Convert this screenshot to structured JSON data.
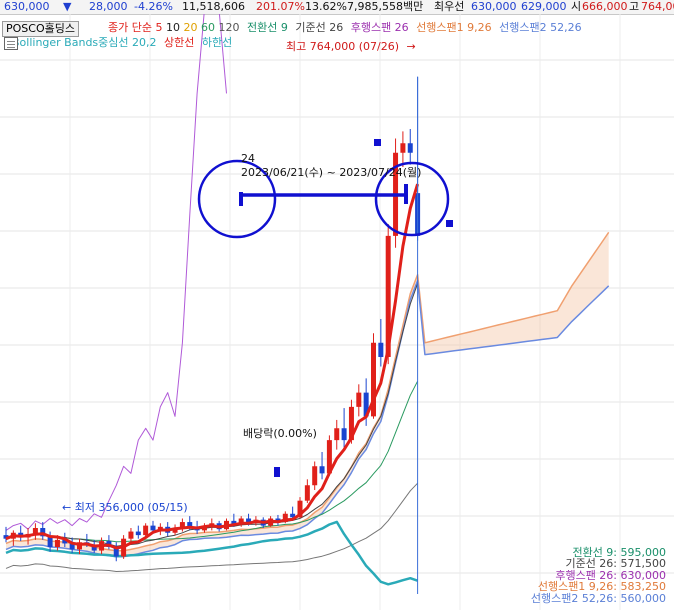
{
  "header": {
    "price": "630,000",
    "arrow": "▼",
    "change": "28,000",
    "change_pct": "-4.26%",
    "volume": "11,518,606",
    "volume_ratio": "201.07%",
    "turnover": "13.62%",
    "amount": "7,985,558백만",
    "best_ask_label": "최우선",
    "best_ask": "630,000",
    "best_bid": "629,000",
    "open_label": "시",
    "open": "666,000",
    "high_label": "고",
    "high": "764,00"
  },
  "legend": {
    "stock_name": "POSCO홀딩스",
    "ma_label": "종가 단순 5",
    "ma10": "10",
    "ma20": "20",
    "ma60": "60",
    "ma120": "120",
    "ichimoku_conv": "전환선 9",
    "ichimoku_base": "기준선 26",
    "ichimoku_lag": "후행스팬 26",
    "ichimoku_lead1": "선행스팬1 9,26",
    "ichimoku_lead2": "선행스팬2 52,26",
    "bb_label": "Bollinger Bands중심선 20,2",
    "bb_upper": "상한선",
    "bb_lower": "하한선"
  },
  "annotations": {
    "high_marker": "최고 764,000 (07/26)",
    "high_arrow": "→",
    "low_marker": "최저 356,000 (05/15)",
    "low_arrow": "←",
    "dividend": "배당락(0.00%)",
    "period_count": "24",
    "period_range": "2023/06/21(수) ~ 2023/07/24(월)"
  },
  "indicator_values": [
    {
      "text": "전환선 9: 595,000",
      "color": "#1a8f6a"
    },
    {
      "text": "기준선 26: 571,500",
      "color": "#444444"
    },
    {
      "text": "후행스팬 26: 630,000",
      "color": "#9b2fae"
    },
    {
      "text": "선행스팬1 9,26: 583,250",
      "color": "#e07a3a"
    },
    {
      "text": "선행스팬2 52,26: 560,000",
      "color": "#5a7fd6"
    }
  ],
  "colors": {
    "up": "#e0201a",
    "down": "#1a44d0",
    "ma5": "#e0201a",
    "lag_span": "#b05ad8",
    "lead1": "#f0a070",
    "lead2": "#6a8ae0",
    "bb": "#2aaab8",
    "conv": "#2a9a60",
    "base": "#555555",
    "annotation": "#1010d0"
  },
  "chart_data": {
    "type": "candlestick",
    "title": "POSCO홀딩스",
    "ylim": [
      320000,
      800000
    ],
    "grid": true,
    "high": {
      "value": 764000,
      "date": "07/26"
    },
    "low": {
      "value": 356000,
      "date": "05/15"
    },
    "period_selection": {
      "from": "2023/06/21",
      "to": "2023/07/24",
      "bars": 24
    },
    "candles": [
      {
        "o": 378000,
        "h": 385000,
        "l": 372000,
        "c": 375000
      },
      {
        "o": 375000,
        "h": 382000,
        "l": 369000,
        "c": 380000
      },
      {
        "o": 380000,
        "h": 386000,
        "l": 373000,
        "c": 376000
      },
      {
        "o": 376000,
        "h": 384000,
        "l": 370000,
        "c": 379000
      },
      {
        "o": 379000,
        "h": 388000,
        "l": 374000,
        "c": 384000
      },
      {
        "o": 384000,
        "h": 389000,
        "l": 374000,
        "c": 377000
      },
      {
        "o": 377000,
        "h": 381000,
        "l": 364000,
        "c": 368000
      },
      {
        "o": 368000,
        "h": 378000,
        "l": 365000,
        "c": 374000
      },
      {
        "o": 374000,
        "h": 380000,
        "l": 368000,
        "c": 371000
      },
      {
        "o": 371000,
        "h": 376000,
        "l": 363000,
        "c": 366000
      },
      {
        "o": 366000,
        "h": 375000,
        "l": 362000,
        "c": 372000
      },
      {
        "o": 372000,
        "h": 379000,
        "l": 368000,
        "c": 370000
      },
      {
        "o": 370000,
        "h": 374000,
        "l": 363000,
        "c": 365000
      },
      {
        "o": 365000,
        "h": 376000,
        "l": 362000,
        "c": 373000
      },
      {
        "o": 373000,
        "h": 378000,
        "l": 366000,
        "c": 368000
      },
      {
        "o": 368000,
        "h": 372000,
        "l": 356000,
        "c": 360000
      },
      {
        "o": 360000,
        "h": 378000,
        "l": 358000,
        "c": 375000
      },
      {
        "o": 375000,
        "h": 384000,
        "l": 371000,
        "c": 381000
      },
      {
        "o": 381000,
        "h": 386000,
        "l": 375000,
        "c": 378000
      },
      {
        "o": 378000,
        "h": 388000,
        "l": 376000,
        "c": 386000
      },
      {
        "o": 386000,
        "h": 390000,
        "l": 379000,
        "c": 382000
      },
      {
        "o": 382000,
        "h": 388000,
        "l": 378000,
        "c": 385000
      },
      {
        "o": 385000,
        "h": 389000,
        "l": 377000,
        "c": 380000
      },
      {
        "o": 380000,
        "h": 387000,
        "l": 378000,
        "c": 384000
      },
      {
        "o": 384000,
        "h": 392000,
        "l": 381000,
        "c": 389000
      },
      {
        "o": 389000,
        "h": 394000,
        "l": 382000,
        "c": 385000
      },
      {
        "o": 385000,
        "h": 390000,
        "l": 379000,
        "c": 382000
      },
      {
        "o": 382000,
        "h": 388000,
        "l": 380000,
        "c": 386000
      },
      {
        "o": 386000,
        "h": 392000,
        "l": 382000,
        "c": 388000
      },
      {
        "o": 388000,
        "h": 390000,
        "l": 381000,
        "c": 383000
      },
      {
        "o": 383000,
        "h": 392000,
        "l": 382000,
        "c": 390000
      },
      {
        "o": 390000,
        "h": 396000,
        "l": 385000,
        "c": 387000
      },
      {
        "o": 387000,
        "h": 394000,
        "l": 385000,
        "c": 392000
      },
      {
        "o": 392000,
        "h": 396000,
        "l": 386000,
        "c": 388000
      },
      {
        "o": 388000,
        "h": 394000,
        "l": 386000,
        "c": 391000
      },
      {
        "o": 391000,
        "h": 393000,
        "l": 384000,
        "c": 386000
      },
      {
        "o": 386000,
        "h": 394000,
        "l": 385000,
        "c": 392000
      },
      {
        "o": 392000,
        "h": 395000,
        "l": 386000,
        "c": 389000
      },
      {
        "o": 389000,
        "h": 398000,
        "l": 388000,
        "c": 396000
      },
      {
        "o": 396000,
        "h": 402000,
        "l": 390000,
        "c": 393000
      },
      {
        "o": 393000,
        "h": 410000,
        "l": 392000,
        "c": 407000
      },
      {
        "o": 407000,
        "h": 425000,
        "l": 405000,
        "c": 420000
      },
      {
        "o": 420000,
        "h": 440000,
        "l": 416000,
        "c": 436000
      },
      {
        "o": 436000,
        "h": 448000,
        "l": 425000,
        "c": 430000
      },
      {
        "o": 430000,
        "h": 462000,
        "l": 428000,
        "c": 458000
      },
      {
        "o": 458000,
        "h": 475000,
        "l": 450000,
        "c": 468000
      },
      {
        "o": 468000,
        "h": 485000,
        "l": 452000,
        "c": 458000
      },
      {
        "o": 458000,
        "h": 492000,
        "l": 455000,
        "c": 486000
      },
      {
        "o": 486000,
        "h": 505000,
        "l": 478000,
        "c": 498000
      },
      {
        "o": 498000,
        "h": 510000,
        "l": 470000,
        "c": 478000
      },
      {
        "o": 478000,
        "h": 548000,
        "l": 476000,
        "c": 540000
      },
      {
        "o": 540000,
        "h": 560000,
        "l": 520000,
        "c": 528000
      },
      {
        "o": 528000,
        "h": 640000,
        "l": 522000,
        "c": 630000
      },
      {
        "o": 630000,
        "h": 712000,
        "l": 620000,
        "c": 700000
      },
      {
        "o": 700000,
        "h": 718000,
        "l": 688000,
        "c": 708000
      },
      {
        "o": 708000,
        "h": 720000,
        "l": 690000,
        "c": 700000
      },
      {
        "o": 666000,
        "h": 764000,
        "l": 626000,
        "c": 630000
      }
    ]
  }
}
